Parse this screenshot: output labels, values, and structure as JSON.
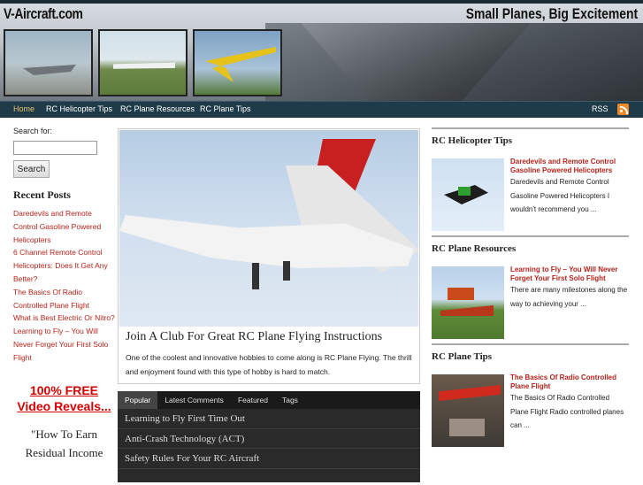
{
  "header": {
    "logo": "V-Aircraft.com",
    "tagline": "Small Planes, Big Excitement"
  },
  "nav": {
    "items": [
      "Home",
      "RC Helicopter Tips",
      "RC Plane Resources",
      "RC Plane Tips"
    ],
    "rss": "RSS"
  },
  "search": {
    "label": "Search for:",
    "value": "",
    "button": "Search"
  },
  "recent": {
    "title": "Recent Posts",
    "items": [
      "Daredevils and Remote Control Gasoline Powered Helicopters",
      "6 Channel Remote Control Helicopters: Does It Get Any Better?",
      "The Basics Of Radio Controlled Plane Flight",
      "What is Best Electric Or Nitro?",
      "Learning to Fly – You Will Never Forget Your First Solo Flight"
    ]
  },
  "promo": {
    "headline": "100% FREE Video Reveals...",
    "quote": "\"How To Earn Residual Income"
  },
  "feature": {
    "title": "Join A Club For Great RC Plane Flying Instructions",
    "text": "One of the coolest and innovative hobbies to come along is RC Plane Flying. The thrill and enjoyment found with this type of hobby is hard to match."
  },
  "tabs": {
    "labels": [
      "Popular",
      "Latest Comments",
      "Featured",
      "Tags"
    ],
    "items": [
      "Learning to Fly First Time Out",
      "Anti-Crash Technology (ACT)",
      "Safety Rules For Your RC Aircraft"
    ]
  },
  "sidebar": {
    "sections": [
      {
        "title": "RC Helicopter Tips",
        "headline": "Daredevils and Remote Control Gasoline Powered Helicopters",
        "excerpt": "Daredevils and Remote Control Gasoline Powered Helicopters I wouldn't recommend you ..."
      },
      {
        "title": "RC Plane Resources",
        "headline": "Learning to Fly – You Will Never Forget Your First Solo Flight",
        "excerpt": "There are many milestones along the way to achieving your ..."
      },
      {
        "title": "RC Plane Tips",
        "headline": "The Basics Of Radio Controlled Plane Flight",
        "excerpt": "The Basics Of Radio Controlled Plane Flight Radio controlled planes can ..."
      }
    ]
  }
}
